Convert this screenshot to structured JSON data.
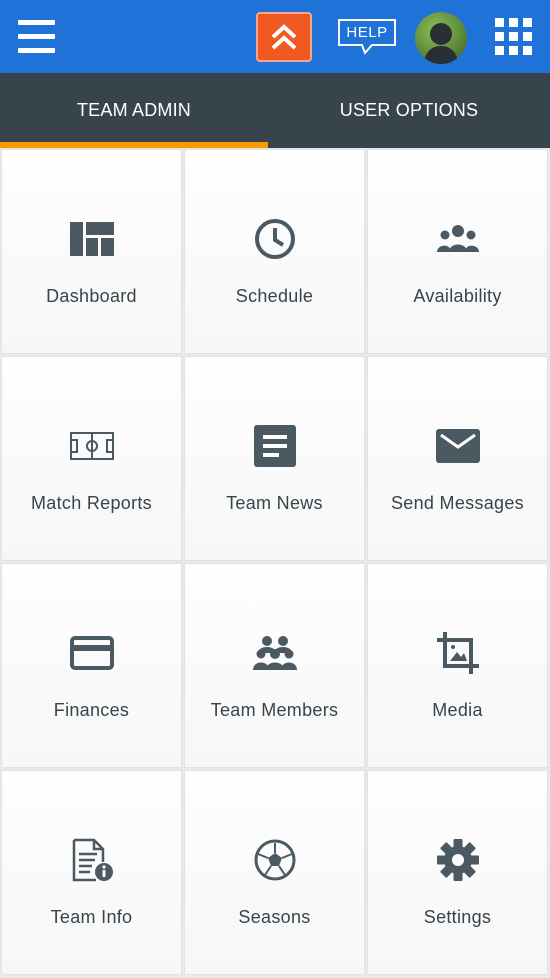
{
  "header": {
    "menu_icon": "hamburger-menu-icon",
    "logo_icon": "double-chevron-up-logo",
    "help_label": "HELP",
    "avatar": "user-avatar",
    "apps_icon": "apps-grid-icon",
    "colors": {
      "bar": "#1f73d8",
      "logo": "#f05a22"
    }
  },
  "tabs": [
    {
      "label": "TEAM ADMIN",
      "active": true
    },
    {
      "label": "USER OPTIONS",
      "active": false
    }
  ],
  "tab_indicator_color": "#ff9800",
  "tiles": [
    {
      "label": "Dashboard",
      "icon": "dashboard-icon"
    },
    {
      "label": "Schedule",
      "icon": "clock-icon"
    },
    {
      "label": "Availability",
      "icon": "people-group-icon"
    },
    {
      "label": "Match Reports",
      "icon": "pitch-icon"
    },
    {
      "label": "Team News",
      "icon": "article-icon"
    },
    {
      "label": "Send Messages",
      "icon": "envelope-icon"
    },
    {
      "label": "Finances",
      "icon": "credit-card-icon"
    },
    {
      "label": "Team Members",
      "icon": "team-members-icon"
    },
    {
      "label": "Media",
      "icon": "crop-image-icon"
    },
    {
      "label": "Team Info",
      "icon": "document-info-icon"
    },
    {
      "label": "Seasons",
      "icon": "soccer-ball-icon"
    },
    {
      "label": "Settings",
      "icon": "gear-icon"
    }
  ]
}
